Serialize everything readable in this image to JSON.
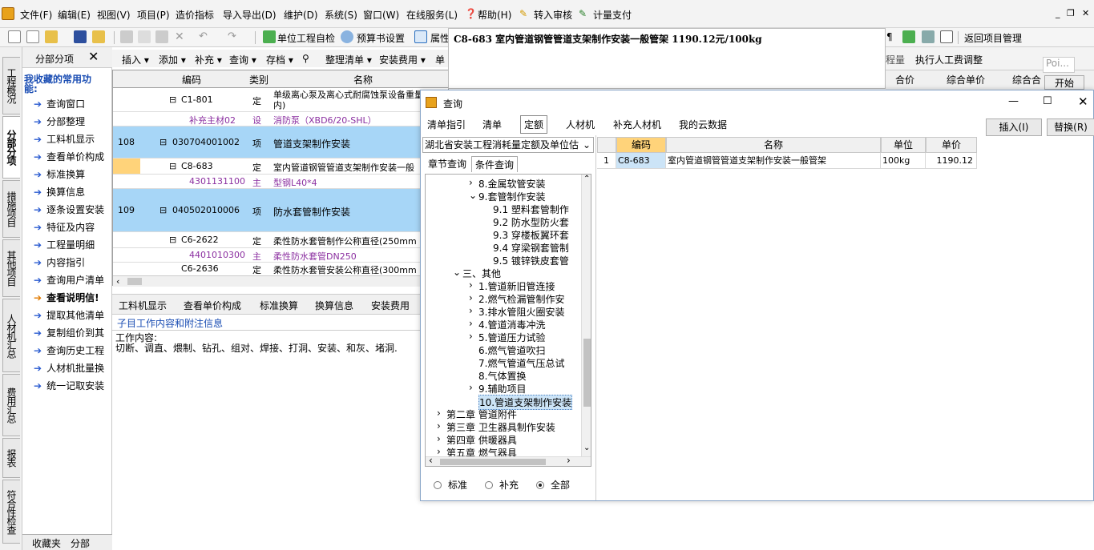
{
  "menu": [
    "文件(F)",
    "编辑(E)",
    "视图(V)",
    "项目(P)",
    "造价指标",
    "导入导出(D)",
    "维护(D)",
    "系统(S)",
    "窗口(W)",
    "在线服务(L)",
    "帮助(H)",
    "转入审核",
    "计量支付"
  ],
  "toolbar": {
    "self_check": "单位工程自检",
    "budget_settings": "预算书设置",
    "attr": "属性",
    "return_project": "返回项目管理"
  },
  "vertical_tabs": [
    "工程概况",
    "分部分项",
    "措施项目",
    "其他项目",
    "人材机汇总",
    "费用汇总",
    "报表",
    "符合性检查"
  ],
  "favorites": {
    "panel_title": "分部分项",
    "close": "✕",
    "group_title": "我收藏的常用功能:",
    "items": [
      "查询窗口",
      "分部整理",
      "工料机显示",
      "查看单价构成",
      "标准换算",
      "换算信息",
      "逐条设置安装",
      "特征及内容",
      "工程量明细",
      "内容指引",
      "查询用户清单",
      "查看说明信!",
      "提取其他清单",
      "复制组价到其",
      "查询历史工程",
      "人材机批量换",
      "统一记取安装"
    ],
    "tab_fav": "收藏夹",
    "tab_fb": "分部"
  },
  "toolbar2": [
    "插入 ▾",
    "添加 ▾",
    "补充 ▾",
    "查询 ▾",
    "存档 ▾",
    "整理清单 ▾",
    "安装费用 ▾",
    "单"
  ],
  "grid": {
    "headers": [
      "编码",
      "类别",
      "名称"
    ],
    "rows": [
      {
        "no": "",
        "code": "C1-801",
        "type": "定",
        "name": "单级离心泵及离心式耐腐蚀泵设备重量(t以内)"
      },
      {
        "no": "",
        "code": "补充主材02",
        "type": "设",
        "name": "消防泵（XBD6/20-SHL）"
      },
      {
        "no": "108",
        "code": "030704001002",
        "type": "项",
        "name": "管道支架制作安装"
      },
      {
        "no": "",
        "code": "C8-683",
        "type": "定",
        "name": "室内管道钢管管道支架制作安装一般"
      },
      {
        "no": "",
        "code": "4301131100",
        "type": "主",
        "name": "型钢L40*4"
      },
      {
        "no": "109",
        "code": "040502010006",
        "type": "项",
        "name": "防水套管制作安装"
      },
      {
        "no": "",
        "code": "C6-2622",
        "type": "定",
        "name": "柔性防水套管制作公称直径(250mm"
      },
      {
        "no": "",
        "code": "4401010300",
        "type": "主",
        "name": "柔性防水套管DN250"
      },
      {
        "no": "",
        "code": "C6-2636",
        "type": "定",
        "name": "柔性防水套管安装公称直径(300mm"
      }
    ]
  },
  "bottom_tabs": [
    "工料机显示",
    "查看单价构成",
    "标准换算",
    "换算信息",
    "安装费用"
  ],
  "sub_info": "子目工作内容和附注信息",
  "work_content": {
    "label": "工作内容:",
    "text": "切断、调直、煨制、钻孔、组对、焊接、打洞、安装、和灰、堵洞."
  },
  "banner": "C8-683 室内管道钢管管道支架制作安装一般管架    1190.12元/100kg",
  "right_grid": {
    "h1": "程量",
    "h2": "执行人工费调整",
    "c1": "合价",
    "c2": "综合单价",
    "c3": "综合合",
    "tooltip": "Poi...",
    "start": "开始"
  },
  "dialog": {
    "title": "查询",
    "tabs": [
      "清单指引",
      "清单",
      "定额",
      "人材机",
      "补充人材机",
      "我的云数据"
    ],
    "insert": "插入(I)",
    "replace": "替换(R)",
    "library": "湖北省安装工程消耗量定额及单位估",
    "subtabs": [
      "章节查询",
      "条件查询"
    ],
    "tree": [
      {
        "t": "8.金属软管安装",
        "lvl": 3,
        "exp": "›"
      },
      {
        "t": "9.套管制作安装",
        "lvl": 3,
        "exp": "⌄"
      },
      {
        "t": "9.1 塑料套管制作",
        "lvl": 4,
        "exp": ""
      },
      {
        "t": "9.2 防水型防火套",
        "lvl": 4,
        "exp": ""
      },
      {
        "t": "9.3 穿楼板翼环套",
        "lvl": 4,
        "exp": ""
      },
      {
        "t": "9.4 穿梁钢套管制",
        "lvl": 4,
        "exp": ""
      },
      {
        "t": "9.5 镀锌铁皮套管",
        "lvl": 4,
        "exp": ""
      },
      {
        "t": "三、其他",
        "lvl": 2,
        "exp": "⌄"
      },
      {
        "t": "1.管道新旧管连接",
        "lvl": 3,
        "exp": "›"
      },
      {
        "t": "2.燃气检漏管制作安",
        "lvl": 3,
        "exp": "›"
      },
      {
        "t": "3.排水管阻火圈安装",
        "lvl": 3,
        "exp": "›"
      },
      {
        "t": "4.管道消毒冲洗",
        "lvl": 3,
        "exp": "›"
      },
      {
        "t": "5.管道压力试验",
        "lvl": 3,
        "exp": "›"
      },
      {
        "t": "6.燃气管道吹扫",
        "lvl": 3,
        "exp": ""
      },
      {
        "t": "7.燃气管道气压总试",
        "lvl": 3,
        "exp": ""
      },
      {
        "t": "8.气体置换",
        "lvl": 3,
        "exp": ""
      },
      {
        "t": "9.辅助项目",
        "lvl": 3,
        "exp": "›"
      },
      {
        "t": "10.管道支架制作安装",
        "lvl": 3,
        "exp": "",
        "sel": true
      },
      {
        "t": "第二章 管道附件",
        "lvl": 1,
        "exp": "›"
      },
      {
        "t": "第三章 卫生器具制作安装",
        "lvl": 1,
        "exp": "›"
      },
      {
        "t": "第四章 供暖器具",
        "lvl": 1,
        "exp": "›"
      },
      {
        "t": "第五章 燃气器具",
        "lvl": 1,
        "exp": "›"
      }
    ],
    "radios": [
      "标准",
      "补充",
      "全部"
    ],
    "table": {
      "headers": [
        "编码",
        "名称",
        "单位",
        "单价"
      ],
      "rows": [
        {
          "no": "1",
          "code": "C8-683",
          "name": "室内管道钢管管道支架制作安装一般管架",
          "unit": "100kg",
          "price": "1190.12"
        }
      ]
    }
  }
}
